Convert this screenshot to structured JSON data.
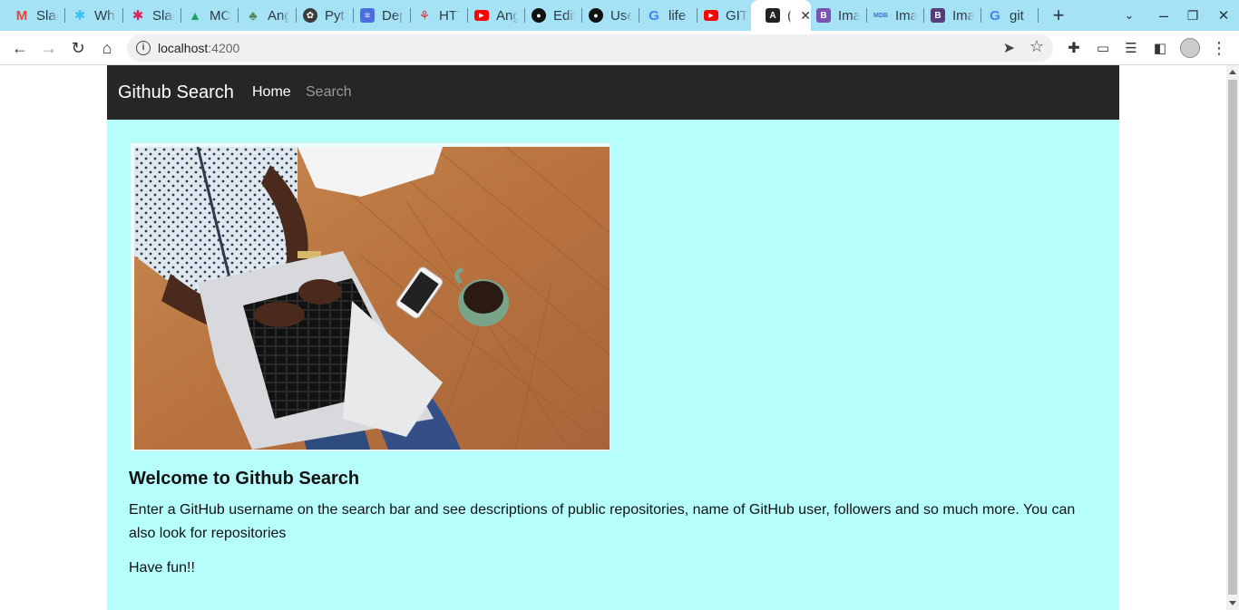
{
  "browser": {
    "tabs": [
      {
        "title": "Slack",
        "icon": "gmail-icon",
        "color": "#ea4335"
      },
      {
        "title": "WhatsApp",
        "icon": "slack-icon",
        "color": "#4a154b"
      },
      {
        "title": "Slack",
        "icon": "slack-icon",
        "color": "#e01e5a"
      },
      {
        "title": "MC",
        "icon": "drive-icon",
        "color": "#1fa463"
      },
      {
        "title": "Angular",
        "icon": "tree-icon",
        "color": "#5a8a5a"
      },
      {
        "title": "Python",
        "icon": "python-icon",
        "color": "#3b3b3b"
      },
      {
        "title": "Deploy",
        "icon": "docs-icon",
        "color": "#4a6ee0"
      },
      {
        "title": "HTTP",
        "icon": "pointer-icon",
        "color": "#d33"
      },
      {
        "title": "Angular",
        "icon": "youtube-icon",
        "color": "#ff0000"
      },
      {
        "title": "Edit",
        "icon": "github-icon",
        "color": "#111111"
      },
      {
        "title": "Use",
        "icon": "github-icon",
        "color": "#111111"
      },
      {
        "title": "life",
        "icon": "google-icon",
        "color": "#4285f4"
      },
      {
        "title": "GIT",
        "icon": "youtube-icon",
        "color": "#ff0000"
      },
      {
        "title": "",
        "icon": "angular-icon",
        "color": "#222222",
        "active": true
      },
      {
        "title": "Images",
        "icon": "bootstrap-icon",
        "color": "#7952b3"
      },
      {
        "title": "Images",
        "icon": "mdb-icon",
        "color": "#3b71ca"
      },
      {
        "title": "Images",
        "icon": "bootstrap-icon",
        "color": "#563d7c"
      },
      {
        "title": "git",
        "icon": "google-icon",
        "color": "#4285f4"
      }
    ],
    "tab_titles_visible": [
      "Slac",
      "Wh",
      "Slac",
      "MC",
      "Ang",
      "Pyt",
      "Dep",
      "HTT",
      "Ang",
      "Edit",
      "Use",
      "life",
      "GIT",
      "(",
      "Ima",
      "Ima",
      "Ima",
      "git"
    ],
    "url_host": "localhost",
    "url_port": ":4200"
  },
  "page": {
    "navbar": {
      "brand": "Github Search",
      "links": [
        "Home",
        "Search"
      ]
    },
    "welcome_heading": "Welcome to Github Search",
    "intro_text": "Enter a GitHub username on the search bar and see descriptions of public repositories, name of GitHub user, followers and so much more. You can also look for repositories",
    "closing_text": "Have fun!!",
    "colors": {
      "navbar_bg": "#262626",
      "content_bg": "#b5fefc",
      "tabstrip_bg": "#a6e2f5"
    }
  }
}
